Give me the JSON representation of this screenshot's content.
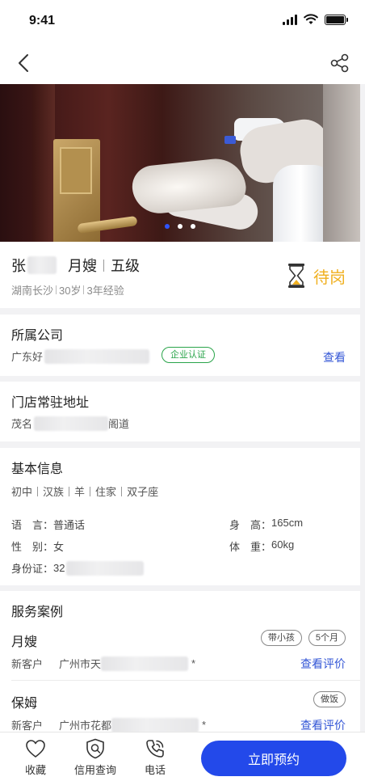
{
  "status_bar": {
    "time": "9:41"
  },
  "hero": {
    "slide_count": 3,
    "active_slide": 0
  },
  "profile": {
    "surname": "张",
    "role": "月嫂",
    "level": "五级",
    "location": "湖南长沙",
    "age": "30岁",
    "experience": "3年经验",
    "status": "待岗",
    "status_color": "#f0b020"
  },
  "company": {
    "title": "所属公司",
    "name_prefix": "广东好",
    "badge": "企业认证",
    "view_label": "查看"
  },
  "address": {
    "title": "门店常驻地址",
    "prefix": "茂名",
    "suffix": "阁道"
  },
  "basic_info": {
    "title": "基本信息",
    "tags": [
      "初中",
      "汉族",
      "羊",
      "住家",
      "双子座"
    ],
    "language_label": "语　言：",
    "language": "普通话",
    "height_label": "身　高：",
    "height": "165cm",
    "gender_label": "性　别：",
    "gender": "女",
    "weight_label": "体　重：",
    "weight": "60kg",
    "id_label": "身份证：",
    "id_prefix": "32"
  },
  "service_cases": {
    "title": "服务案例",
    "cases": [
      {
        "type": "月嫂",
        "tags": [
          "带小孩",
          "5个月"
        ],
        "customer": "新客户",
        "address_prefix": "广州市天",
        "address_suffix": "*",
        "review_label": "查看评价"
      },
      {
        "type": "保姆",
        "tags": [
          "做饭"
        ],
        "customer": "新客户",
        "address_prefix": "广州市花都",
        "address_suffix": "*",
        "review_label": "查看评价"
      }
    ]
  },
  "bottom_bar": {
    "favorite": "收藏",
    "credit": "信用查询",
    "phone": "电话",
    "book": "立即预约"
  },
  "colors": {
    "accent": "#2349ea",
    "link": "#3356d6",
    "cert": "#2aa44a"
  }
}
